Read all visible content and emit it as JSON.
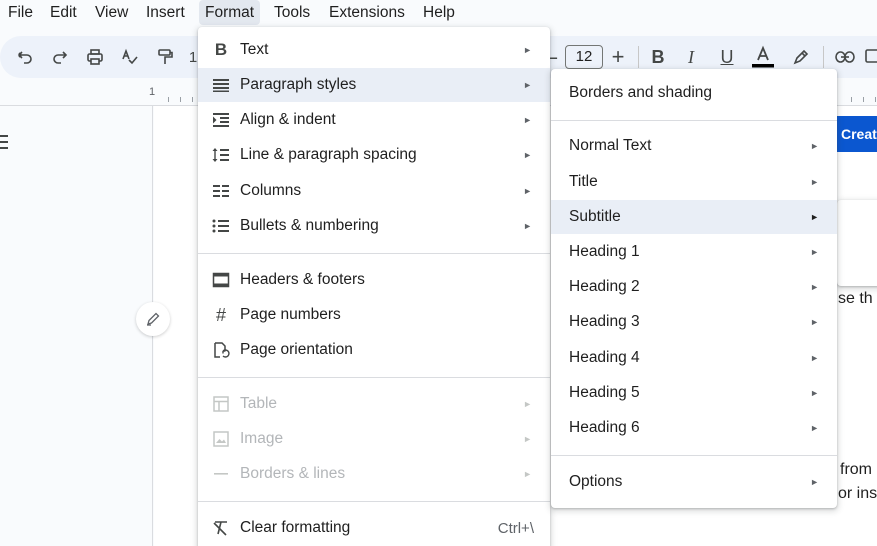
{
  "menubar": {
    "items": [
      "File",
      "Edit",
      "View",
      "Insert",
      "Format",
      "Tools",
      "Extensions",
      "Help"
    ]
  },
  "toolbar": {
    "font_size": "12",
    "zoom_partial": "1"
  },
  "ruler": {
    "first_number": "1"
  },
  "document": {
    "create_button": "Create",
    "text_fragments": [
      "se th",
      "from",
      "or ins"
    ]
  },
  "format_menu": {
    "items": [
      {
        "label": "Text",
        "icon": "bold-b-icon",
        "has_submenu": true
      },
      {
        "label": "Paragraph styles",
        "icon": "paragraph-lines-icon",
        "has_submenu": true
      },
      {
        "label": "Align & indent",
        "icon": "indent-icon",
        "has_submenu": true
      },
      {
        "label": "Line & paragraph spacing",
        "icon": "line-spacing-icon",
        "has_submenu": true
      },
      {
        "label": "Columns",
        "icon": "columns-icon",
        "has_submenu": true
      },
      {
        "label": "Bullets & numbering",
        "icon": "bulleted-list-icon",
        "has_submenu": true
      },
      {
        "label": "Headers & footers",
        "icon": "header-footer-icon",
        "has_submenu": false
      },
      {
        "label": "Page numbers",
        "icon": "hash-icon",
        "has_submenu": false
      },
      {
        "label": "Page orientation",
        "icon": "page-orientation-icon",
        "has_submenu": false
      },
      {
        "label": "Table",
        "icon": "table-icon",
        "has_submenu": true,
        "disabled": true
      },
      {
        "label": "Image",
        "icon": "image-icon",
        "has_submenu": true,
        "disabled": true
      },
      {
        "label": "Borders & lines",
        "icon": "horizontal-line-icon",
        "has_submenu": true,
        "disabled": true
      },
      {
        "label": "Clear formatting",
        "icon": "clear-formatting-icon",
        "shortcut": "Ctrl+\\"
      }
    ]
  },
  "paragraph_styles_menu": {
    "items": [
      {
        "label": "Borders and shading",
        "has_submenu": false
      },
      {
        "label": "Normal Text",
        "has_submenu": true
      },
      {
        "label": "Title",
        "has_submenu": true
      },
      {
        "label": "Subtitle",
        "has_submenu": true
      },
      {
        "label": "Heading 1",
        "has_submenu": true
      },
      {
        "label": "Heading 2",
        "has_submenu": true
      },
      {
        "label": "Heading 3",
        "has_submenu": true
      },
      {
        "label": "Heading 4",
        "has_submenu": true
      },
      {
        "label": "Heading 5",
        "has_submenu": true
      },
      {
        "label": "Heading 6",
        "has_submenu": true
      },
      {
        "label": "Options",
        "has_submenu": true
      }
    ]
  },
  "colors": {
    "accent": "#0b57d0",
    "menu_hover": "#e9eef6",
    "toolbar_bg": "#edf2fa"
  }
}
